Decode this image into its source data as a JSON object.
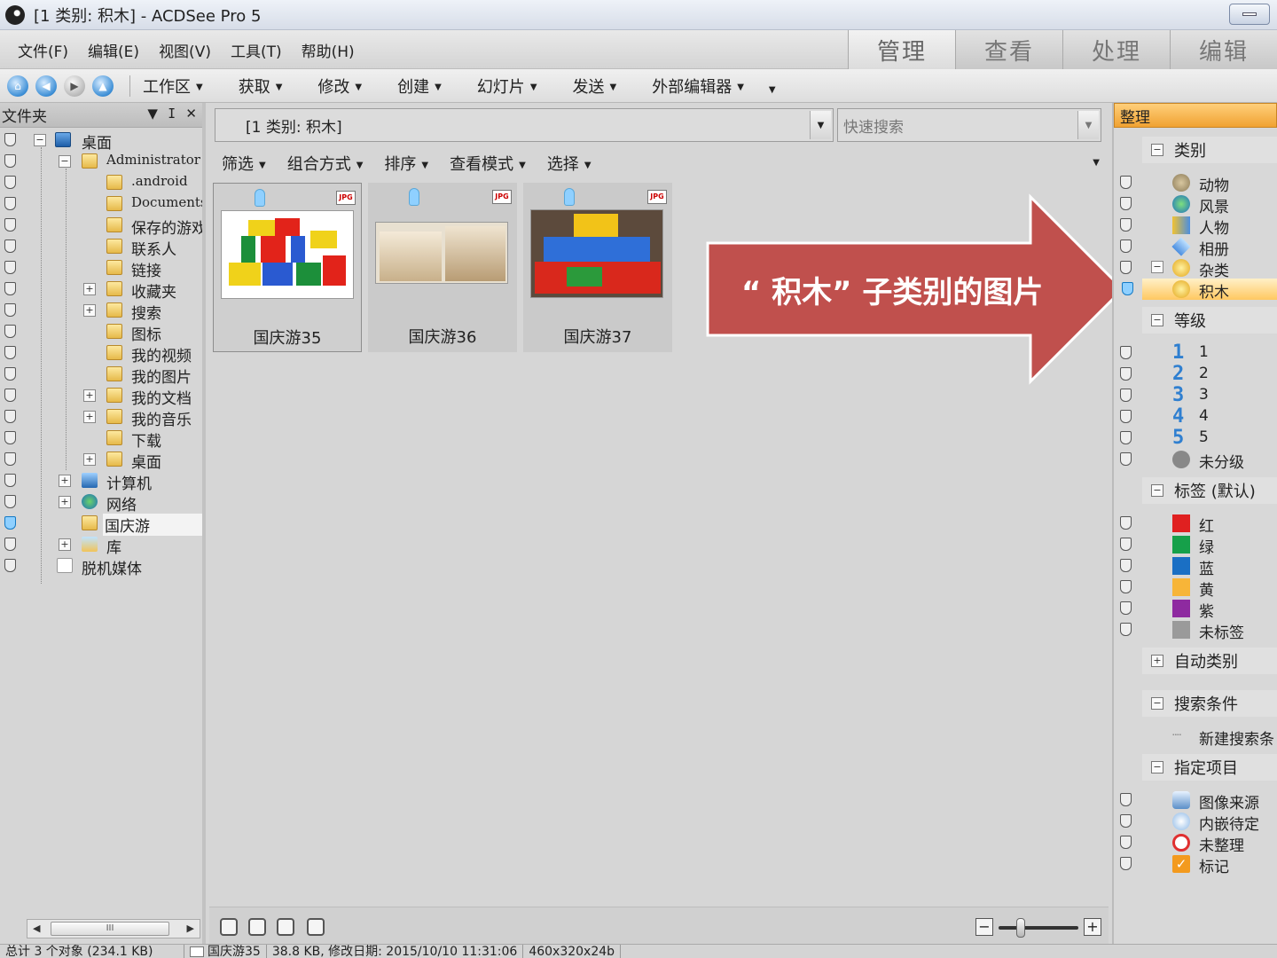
{
  "window": {
    "title": "[1 类别: 积木] - ACDSee Pro 5"
  },
  "menu": [
    "文件(F)",
    "编辑(E)",
    "视图(V)",
    "工具(T)",
    "帮助(H)"
  ],
  "modes": [
    "管理",
    "查看",
    "处理",
    "编辑"
  ],
  "toolbar": [
    "工作区",
    "获取",
    "修改",
    "创建",
    "幻灯片",
    "发送",
    "外部编辑器"
  ],
  "folders_panel": {
    "title": "文件夹",
    "tree": [
      {
        "label": "桌面"
      },
      {
        "label": "Administrator"
      },
      {
        "label": ".android"
      },
      {
        "label": "Documents"
      },
      {
        "label": "保存的游戏"
      },
      {
        "label": "联系人"
      },
      {
        "label": "链接"
      },
      {
        "label": "收藏夹"
      },
      {
        "label": "搜索"
      },
      {
        "label": "图标"
      },
      {
        "label": "我的视频"
      },
      {
        "label": "我的图片"
      },
      {
        "label": "我的文档"
      },
      {
        "label": "我的音乐"
      },
      {
        "label": "下载"
      },
      {
        "label": "桌面"
      },
      {
        "label": "计算机"
      },
      {
        "label": "网络"
      },
      {
        "label": "国庆游"
      },
      {
        "label": "库"
      },
      {
        "label": "脱机媒体"
      }
    ]
  },
  "address": {
    "path": "[1 类别: 积木]",
    "quick_search": "快速搜索"
  },
  "filter_bar": [
    "筛选",
    "组合方式",
    "排序",
    "查看模式",
    "选择"
  ],
  "thumbnails": [
    {
      "name": "国庆游35",
      "badge": "JPG"
    },
    {
      "name": "国庆游36",
      "badge": "JPG"
    },
    {
      "name": "国庆游37",
      "badge": "JPG"
    }
  ],
  "callout": {
    "text": "“ 积木” 子类别的图片",
    "color": "#c0504d"
  },
  "organize_panel": {
    "title": "整理",
    "categories_title": "类别",
    "categories": [
      "动物",
      "风景",
      "人物",
      "相册",
      "杂类"
    ],
    "subcategory": "积木",
    "ratings_title": "等级",
    "ratings": [
      "1",
      "2",
      "3",
      "4",
      "5"
    ],
    "unrated": "未分级",
    "labels_title": "标签 (默认)",
    "labels": [
      {
        "name": "红",
        "color": "#e02020"
      },
      {
        "name": "绿",
        "color": "#16a04a"
      },
      {
        "name": "蓝",
        "color": "#1a6fc4"
      },
      {
        "name": "黄",
        "color": "#f7b538"
      },
      {
        "name": "紫",
        "color": "#8e2aa0"
      },
      {
        "name": "未标签",
        "color": "#9a9a9a"
      }
    ],
    "auto_categories": "自动类别",
    "saved_search_title": "搜索条件",
    "new_search": "新建搜索条",
    "special_title": "指定项目",
    "special": [
      "图像来源",
      "内嵌待定",
      "未整理",
      "标记"
    ]
  },
  "statusbar": {
    "total": "总计 3 个对象 (234.1 KB)",
    "file": "国庆游35",
    "info": "38.8 KB, 修改日期: 2015/10/10 11:31:06",
    "dims": "460x320x24b"
  }
}
